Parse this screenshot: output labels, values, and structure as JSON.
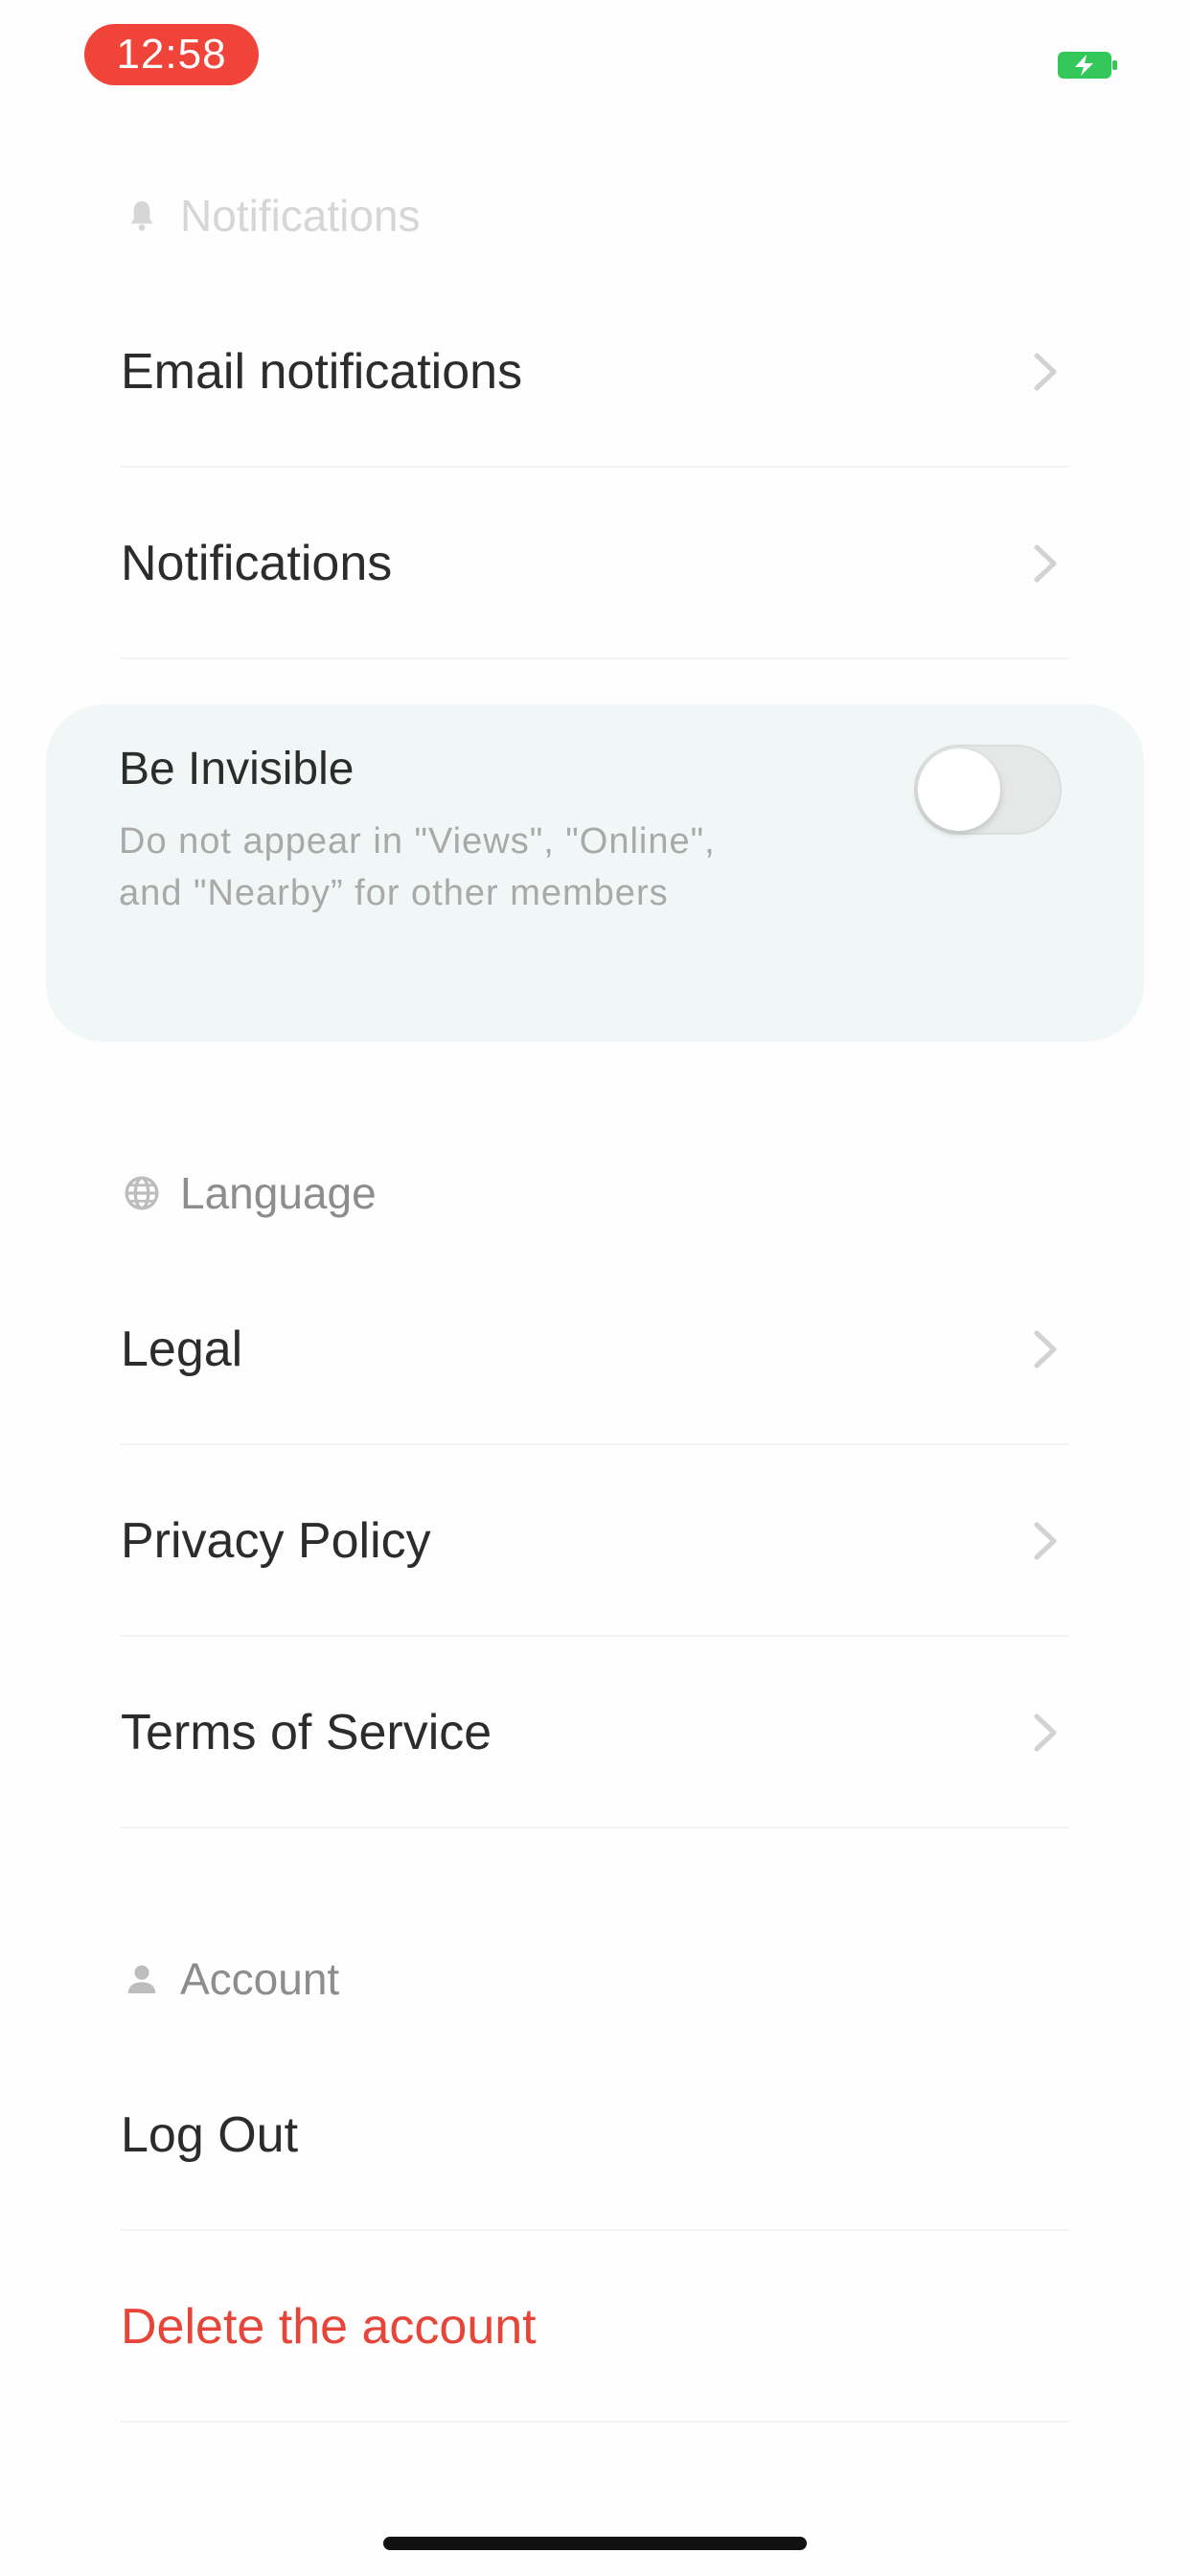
{
  "status_bar": {
    "time": "12:58",
    "battery_color": "#34c759",
    "time_pill_color": "#f0443a"
  },
  "sections": {
    "notifications": {
      "header": "Notifications",
      "icon": "bell-icon",
      "items": [
        {
          "label": "Email notifications",
          "icon": "chevron-right-icon"
        },
        {
          "label": "Notifications",
          "icon": "chevron-right-icon"
        }
      ]
    },
    "invisible": {
      "title": "Be Invisible",
      "description": "Do not appear in \"Views\", \"Online\", and \"Nearby” for other members",
      "toggle_on": false,
      "card_color": "#f1f7f6"
    },
    "language": {
      "header": "Language",
      "icon": "globe-icon",
      "items": [
        {
          "label": "Legal",
          "icon": "chevron-right-icon"
        },
        {
          "label": "Privacy Policy",
          "icon": "chevron-right-icon"
        },
        {
          "label": "Terms of Service",
          "icon": "chevron-right-icon"
        }
      ]
    },
    "account": {
      "header": "Account",
      "icon": "user-icon",
      "items": [
        {
          "label": "Log Out"
        },
        {
          "label": "Delete the account",
          "color": "#e6453a"
        }
      ]
    }
  }
}
